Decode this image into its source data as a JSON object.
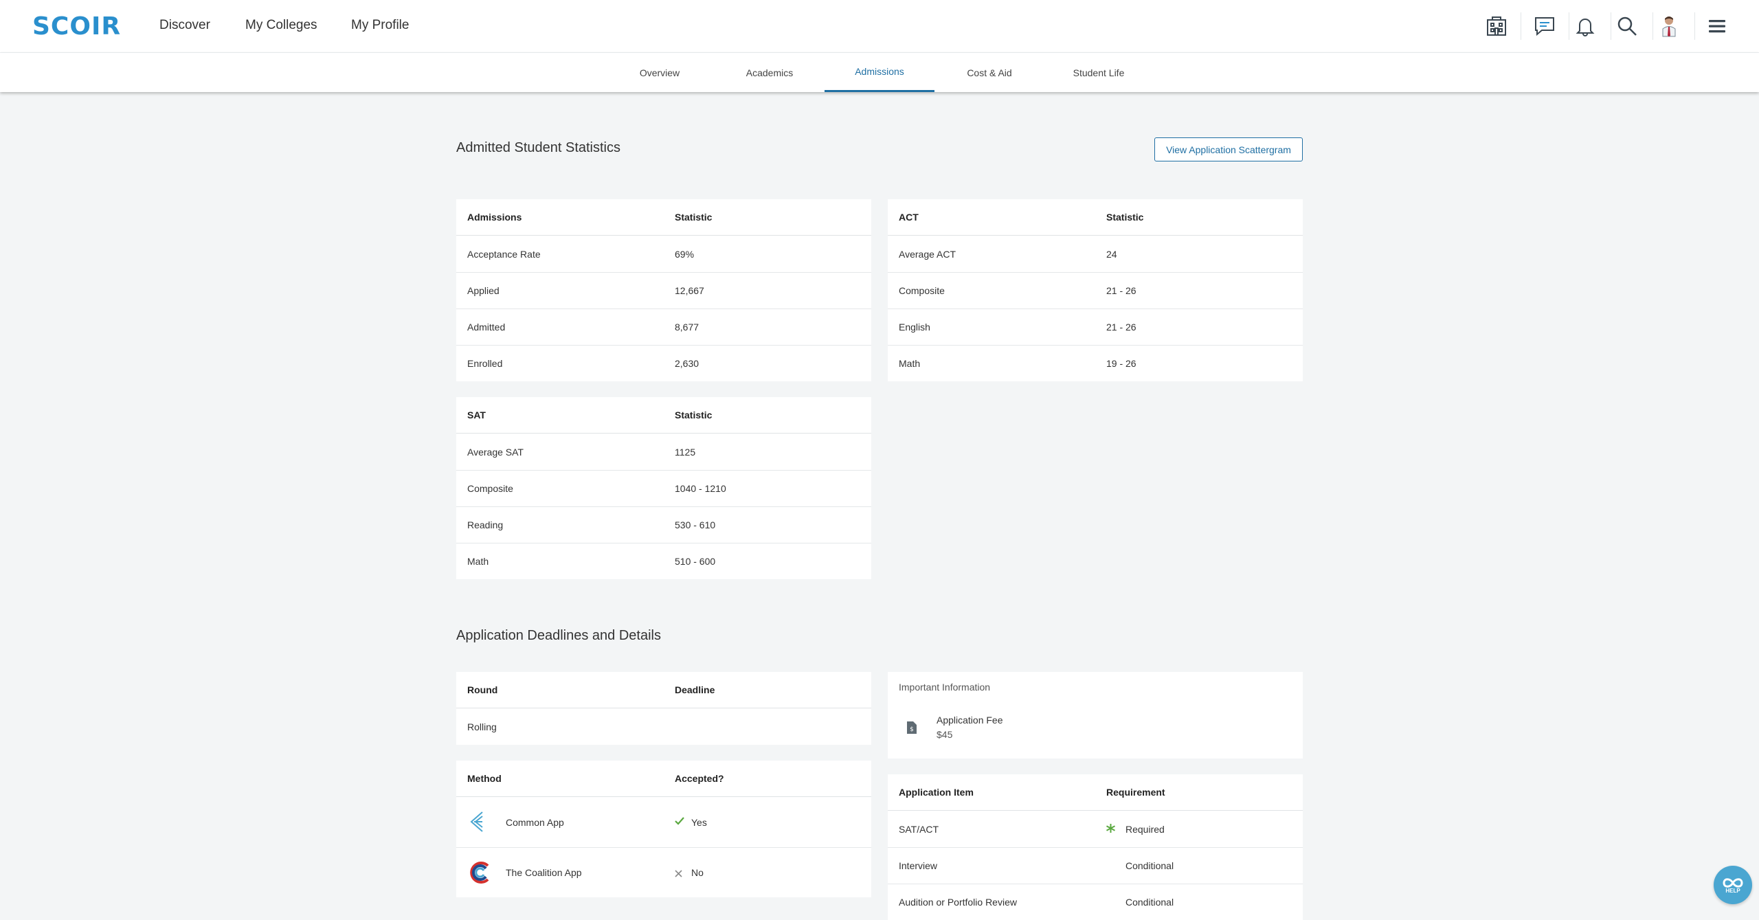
{
  "brand": {
    "logo_text": "SCOIR",
    "accent": "#2a8fcd",
    "active_tab_color": "#1f6fa3"
  },
  "topnav": {
    "links": [
      {
        "label": "Discover"
      },
      {
        "label": "My Colleges"
      },
      {
        "label": "My Profile"
      }
    ],
    "icons": [
      "colleges-building-icon",
      "messages-icon",
      "notifications-bell-icon",
      "search-icon",
      "user-avatar",
      "hamburger-menu-icon"
    ]
  },
  "subnav": {
    "tabs": [
      {
        "label": "Overview"
      },
      {
        "label": "Academics"
      },
      {
        "label": "Admissions",
        "active": true
      },
      {
        "label": "Cost & Aid"
      },
      {
        "label": "Student Life"
      }
    ]
  },
  "stats": {
    "title": "Admitted Student Statistics",
    "scattergram_button": "View Application Scattergram",
    "admissions": {
      "headers": [
        "Admissions",
        "Statistic"
      ],
      "rows": [
        [
          "Acceptance Rate",
          "69%"
        ],
        [
          "Applied",
          "12,667"
        ],
        [
          "Admitted",
          "8,677"
        ],
        [
          "Enrolled",
          "2,630"
        ]
      ]
    },
    "act": {
      "headers": [
        "ACT",
        "Statistic"
      ],
      "rows": [
        [
          "Average ACT",
          "24"
        ],
        [
          "Composite",
          "21 - 26"
        ],
        [
          "English",
          "21 - 26"
        ],
        [
          "Math",
          "19 - 26"
        ]
      ]
    },
    "sat": {
      "headers": [
        "SAT",
        "Statistic"
      ],
      "rows": [
        [
          "Average SAT",
          "1125"
        ],
        [
          "Composite",
          "1040 - 1210"
        ],
        [
          "Reading",
          "530 - 610"
        ],
        [
          "Math",
          "510 - 600"
        ]
      ]
    }
  },
  "deadlines": {
    "title": "Application Deadlines and Details",
    "rounds": {
      "headers": [
        "Round",
        "Deadline"
      ],
      "rows": [
        [
          "Rolling",
          ""
        ]
      ]
    },
    "methods": {
      "headers": [
        "Method",
        "Accepted?"
      ],
      "rows": [
        {
          "name": "Common App",
          "accepted": "Yes",
          "icon": "common-app-logo",
          "status_icon": "check-icon"
        },
        {
          "name": "The Coalition App",
          "accepted": "No",
          "icon": "coalition-app-logo",
          "status_icon": "x-icon"
        }
      ]
    },
    "important": {
      "label": "Important Information",
      "fee_title": "Application Fee",
      "fee_value": "$45"
    },
    "requirements": {
      "headers": [
        "Application Item",
        "Requirement"
      ],
      "rows": [
        [
          "SAT/ACT",
          "Required"
        ],
        [
          "Interview",
          "Conditional"
        ],
        [
          "Audition or Portfolio Review",
          "Conditional"
        ]
      ]
    }
  },
  "help": {
    "label": "HELP"
  }
}
